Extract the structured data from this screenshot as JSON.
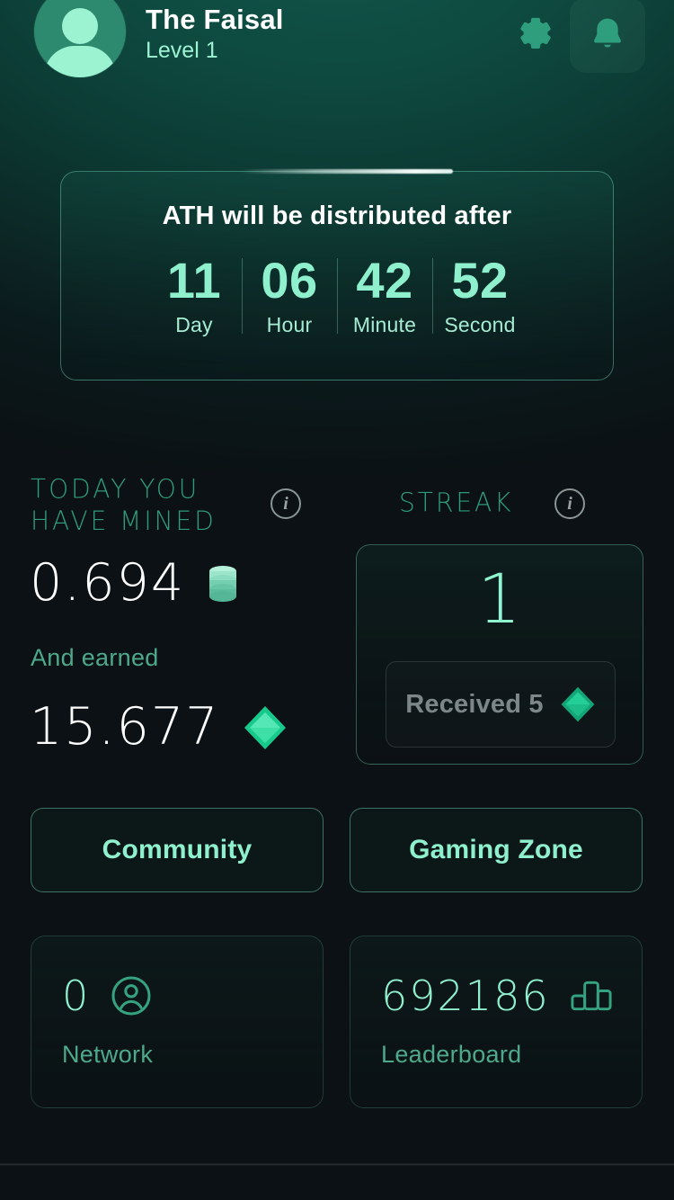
{
  "header": {
    "username": "The Faisal",
    "level": "Level 1",
    "avatar_icon": "user-avatar-icon",
    "settings_icon": "gear-icon",
    "notifications_icon": "bell-icon"
  },
  "countdown": {
    "title": "ATH will be distributed after",
    "units": [
      {
        "value": "11",
        "label": "Day"
      },
      {
        "value": "06",
        "label": "Hour"
      },
      {
        "value": "42",
        "label": "Minute"
      },
      {
        "value": "52",
        "label": "Second"
      }
    ]
  },
  "mined": {
    "heading_line1": "TODAY YOU",
    "heading_line2": "HAVE MINED",
    "info_icon": "info-icon",
    "amount": "0.694",
    "amount_icon": "coin-stack-icon",
    "earned_label": "And earned",
    "earned_amount": "15.677",
    "earned_icon": "gem-icon"
  },
  "streak": {
    "heading": "STREAK",
    "info_icon": "info-icon",
    "value": "1",
    "button_label": "Received 5",
    "button_icon": "gem-icon"
  },
  "actions": {
    "community": "Community",
    "gaming_zone": "Gaming Zone"
  },
  "stats": [
    {
      "value": "0",
      "label": "Network",
      "icon": "user-circle-icon"
    },
    {
      "value": "692186",
      "label": "Leaderboard",
      "icon": "podium-chart-icon"
    }
  ],
  "colors": {
    "accent_mint": "#8ff0cd",
    "accent_green": "#2f9c79",
    "gem_green": "#1fc48c",
    "bg_top": "#0e4a40",
    "bg_bottom": "#0b1114",
    "text_white": "#ffffff",
    "muted": "#7d878a"
  }
}
